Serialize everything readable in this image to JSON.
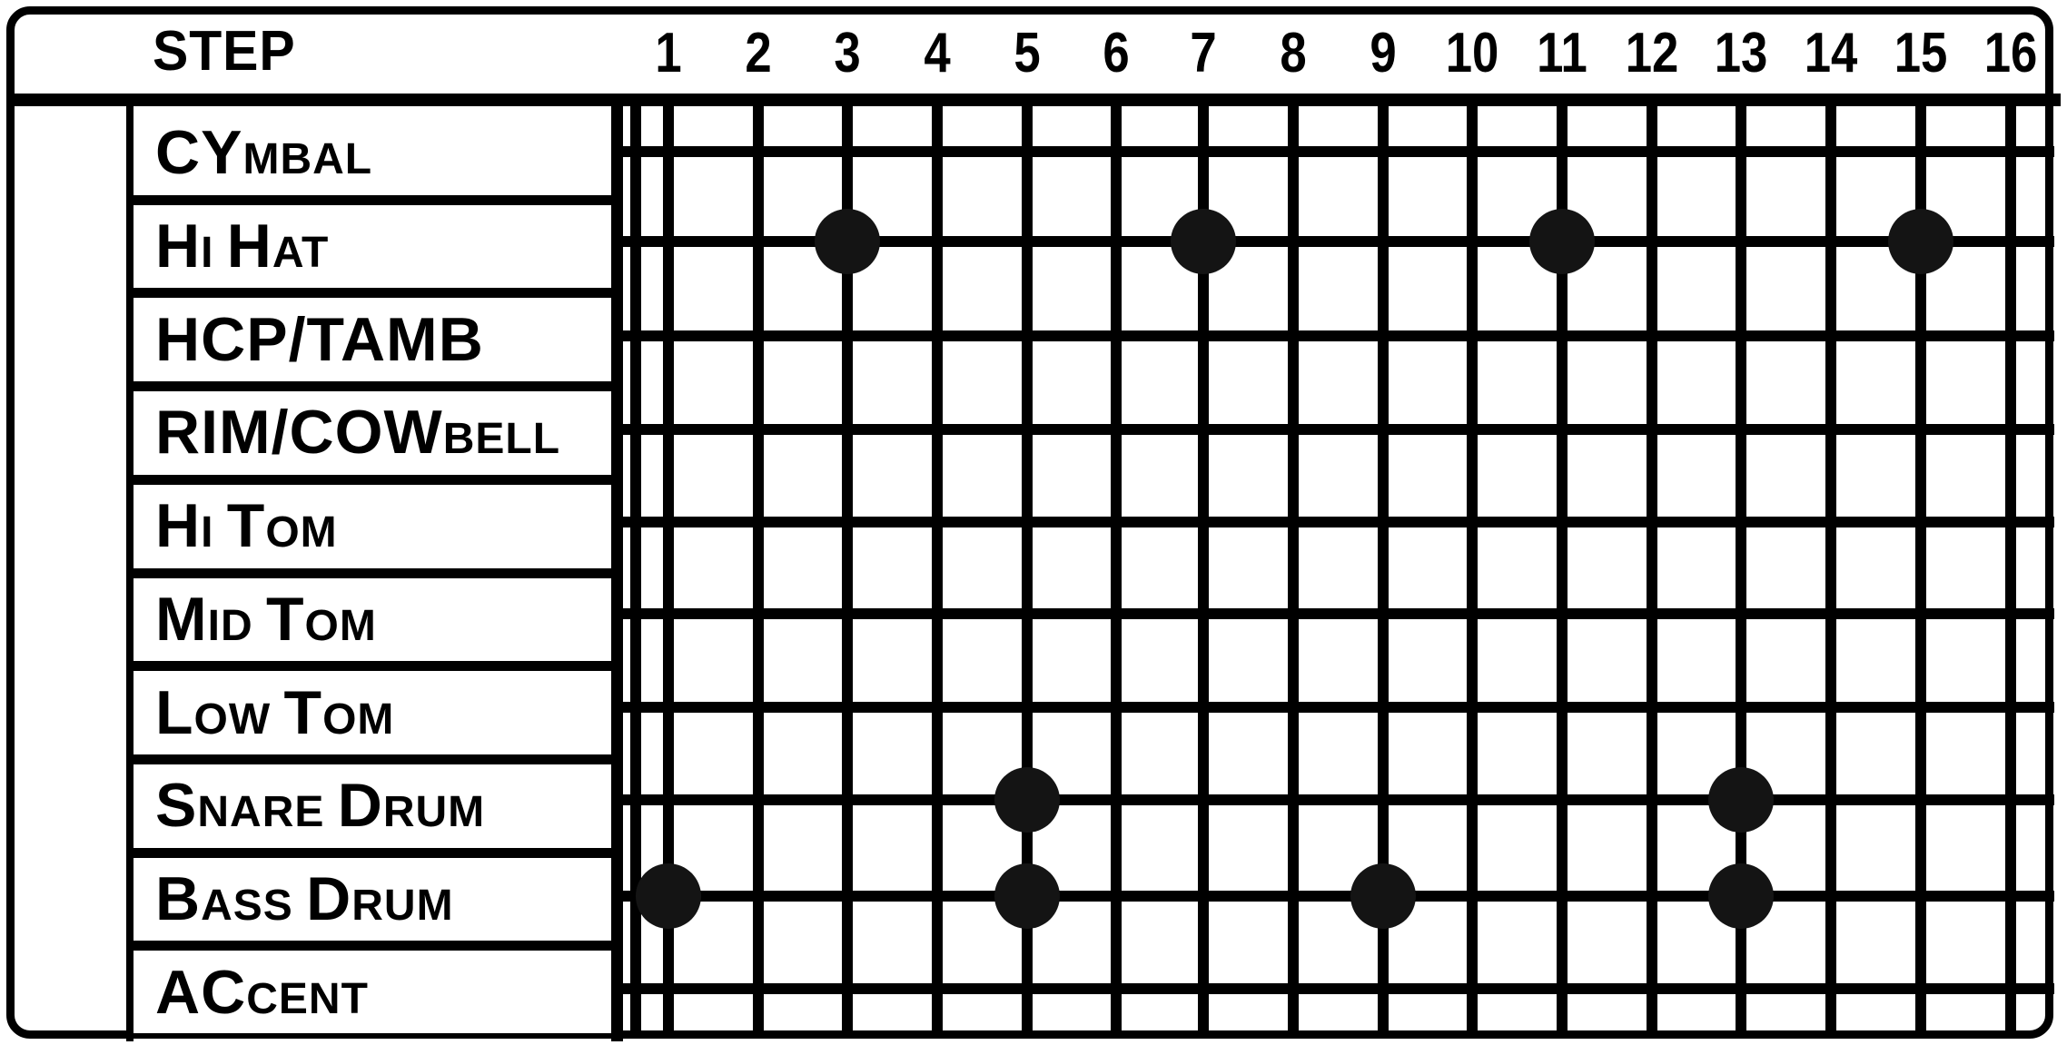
{
  "header": {
    "title": "STEP",
    "steps": [
      "1",
      "2",
      "3",
      "4",
      "5",
      "6",
      "7",
      "8",
      "9",
      "10",
      "11",
      "12",
      "13",
      "14",
      "15",
      "16"
    ]
  },
  "instruments": [
    {
      "label_parts": [
        {
          "t": "CY",
          "sc": false
        },
        {
          "t": "MBAL",
          "sc": true
        }
      ],
      "label": "CYMBAL",
      "active_steps": []
    },
    {
      "label_parts": [
        {
          "t": "H",
          "sc": false
        },
        {
          "t": "I ",
          "sc": true
        },
        {
          "t": "H",
          "sc": false
        },
        {
          "t": "AT",
          "sc": true
        }
      ],
      "label": "HI HAT",
      "active_steps": [
        3,
        7,
        11,
        15
      ]
    },
    {
      "label_parts": [
        {
          "t": "HCP/TAMB",
          "sc": false
        }
      ],
      "label": "HCP/TAMB",
      "active_steps": []
    },
    {
      "label_parts": [
        {
          "t": "RIM/COW",
          "sc": false
        },
        {
          "t": "BELL",
          "sc": true
        }
      ],
      "label": "RIM/COWBELL",
      "active_steps": []
    },
    {
      "label_parts": [
        {
          "t": "H",
          "sc": false
        },
        {
          "t": "I ",
          "sc": true
        },
        {
          "t": "T",
          "sc": false
        },
        {
          "t": "OM",
          "sc": true
        }
      ],
      "label": "HI TOM",
      "active_steps": []
    },
    {
      "label_parts": [
        {
          "t": "M",
          "sc": false
        },
        {
          "t": "ID ",
          "sc": true
        },
        {
          "t": "T",
          "sc": false
        },
        {
          "t": "OM",
          "sc": true
        }
      ],
      "label": "MID TOM",
      "active_steps": []
    },
    {
      "label_parts": [
        {
          "t": "L",
          "sc": false
        },
        {
          "t": "OW  ",
          "sc": true
        },
        {
          "t": "T",
          "sc": false
        },
        {
          "t": "OM",
          "sc": true
        }
      ],
      "label": "LOW TOM",
      "active_steps": []
    },
    {
      "label_parts": [
        {
          "t": "S",
          "sc": false
        },
        {
          "t": "NARE ",
          "sc": true
        },
        {
          "t": "D",
          "sc": false
        },
        {
          "t": "RUM",
          "sc": true
        }
      ],
      "label": "SNARE DRUM",
      "active_steps": [
        5,
        13
      ]
    },
    {
      "label_parts": [
        {
          "t": "B",
          "sc": false
        },
        {
          "t": "ASS ",
          "sc": true
        },
        {
          "t": "D",
          "sc": false
        },
        {
          "t": "RUM",
          "sc": true
        }
      ],
      "label": "BASS DRUM",
      "active_steps": [
        1,
        5,
        9,
        13
      ]
    },
    {
      "label_parts": [
        {
          "t": "AC",
          "sc": false
        },
        {
          "t": "CENT",
          "sc": true
        }
      ],
      "label": "ACCENT",
      "active_steps": []
    }
  ],
  "colors": {
    "ink": "#000000",
    "paper": "#ffffff",
    "note": "#141414"
  }
}
